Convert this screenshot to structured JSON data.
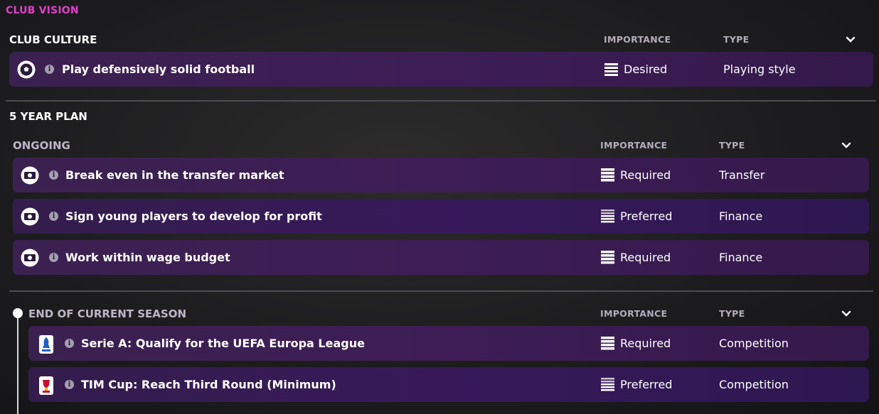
{
  "page_title": "CLUB VISION",
  "club_culture": {
    "title": "CLUB CULTURE",
    "importance_header": "IMPORTANCE",
    "type_header": "TYPE",
    "items": [
      {
        "label": "Play defensively solid football",
        "importance": "Desired",
        "type": "Playing style",
        "icon": "football-icon",
        "importance_icon": "importance-desired-icon"
      }
    ]
  },
  "five_year_plan": {
    "title": "5 YEAR PLAN",
    "ongoing": {
      "title": "ONGOING",
      "importance_header": "IMPORTANCE",
      "type_header": "TYPE",
      "items": [
        {
          "label": "Break even in the transfer market",
          "importance": "Required",
          "type": "Transfer",
          "icon": "money-icon"
        },
        {
          "label": "Sign young players to develop for profit",
          "importance": "Preferred",
          "type": "Finance",
          "icon": "money-icon"
        },
        {
          "label": "Work within wage budget",
          "importance": "Required",
          "type": "Finance",
          "icon": "money-icon"
        }
      ]
    },
    "end_of_season": {
      "title": "END OF CURRENT SEASON",
      "importance_header": "IMPORTANCE",
      "type_header": "TYPE",
      "items": [
        {
          "label": "Serie A: Qualify for the UEFA Europa League",
          "importance": "Required",
          "type": "Competition",
          "icon": "serie-a-logo-icon"
        },
        {
          "label": "TIM Cup: Reach Third Round (Minimum)",
          "importance": "Preferred",
          "type": "Competition",
          "icon": "coppa-italia-logo-icon"
        }
      ]
    }
  },
  "colors": {
    "accent": "#e040c8",
    "row": "#3d1e54",
    "divider": "#4e4c52"
  }
}
